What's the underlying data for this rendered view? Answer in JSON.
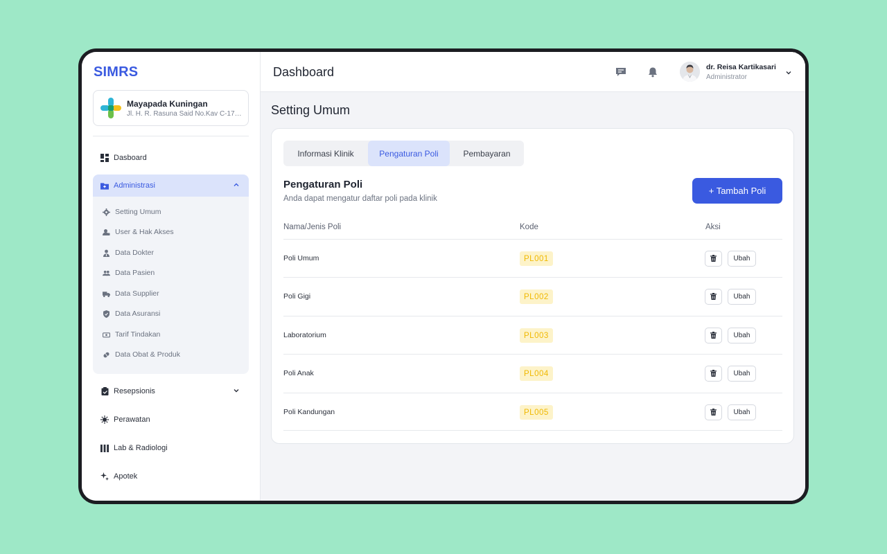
{
  "app": {
    "logo": "SIMRS"
  },
  "clinic": {
    "name": "Mayapada Kuningan",
    "address": "Jl. H. R. Rasuna Said No.Kav C-17, R..."
  },
  "sidebar": {
    "items": [
      {
        "label": "Dasboard",
        "icon": "dashboard-icon"
      },
      {
        "label": "Administrasi",
        "icon": "folder-icon",
        "active": true
      },
      {
        "label": "Resepsionis",
        "icon": "clipboard-icon"
      },
      {
        "label": "Perawatan",
        "icon": "virus-icon"
      },
      {
        "label": "Lab & Radiologi",
        "icon": "lab-icon"
      },
      {
        "label": "Apotek",
        "icon": "pharmacy-icon"
      }
    ],
    "submenu": [
      {
        "label": "Setting Umum",
        "icon": "gear-icon"
      },
      {
        "label": "User & Hak Akses",
        "icon": "user-lock-icon"
      },
      {
        "label": "Data Dokter",
        "icon": "doctor-icon"
      },
      {
        "label": "Data Pasien",
        "icon": "people-icon"
      },
      {
        "label": "Data Supplier",
        "icon": "truck-icon"
      },
      {
        "label": "Data Asuransi",
        "icon": "shield-icon"
      },
      {
        "label": "Tarif Tindakan",
        "icon": "money-icon"
      },
      {
        "label": "Data Obat & Produk",
        "icon": "pill-icon"
      }
    ]
  },
  "topbar": {
    "title": "Dashboard",
    "user": {
      "name": "dr. Reisa Kartikasari",
      "role": "Administrator"
    }
  },
  "page": {
    "title": "Setting Umum",
    "tabs": [
      {
        "label": "Informasi Klinik",
        "active": false
      },
      {
        "label": "Pengaturan Poli",
        "active": true
      },
      {
        "label": "Pembayaran",
        "active": false
      }
    ],
    "section": {
      "title": "Pengaturan Poli",
      "description": "Anda dapat mengatur daftar poli pada klinik",
      "add_button": "+ Tambah Poli"
    },
    "table": {
      "headers": [
        "Nama/Jenis Poli",
        "Kode",
        "Aksi"
      ],
      "rows": [
        {
          "name": "Poli Umum",
          "code": "PL001",
          "edit": "Ubah"
        },
        {
          "name": "Poli Gigi",
          "code": "PL002",
          "edit": "Ubah"
        },
        {
          "name": "Laboratorium",
          "code": "PL003",
          "edit": "Ubah"
        },
        {
          "name": "Poli Anak",
          "code": "PL004",
          "edit": "Ubah"
        },
        {
          "name": "Poli Kandungan",
          "code": "PL005",
          "edit": "Ubah"
        }
      ]
    }
  },
  "colors": {
    "brand": "#3a5ae0",
    "active_bg": "#dbe3fb",
    "badge_bg": "#fdf3c9",
    "badge_text": "#f0b800"
  }
}
